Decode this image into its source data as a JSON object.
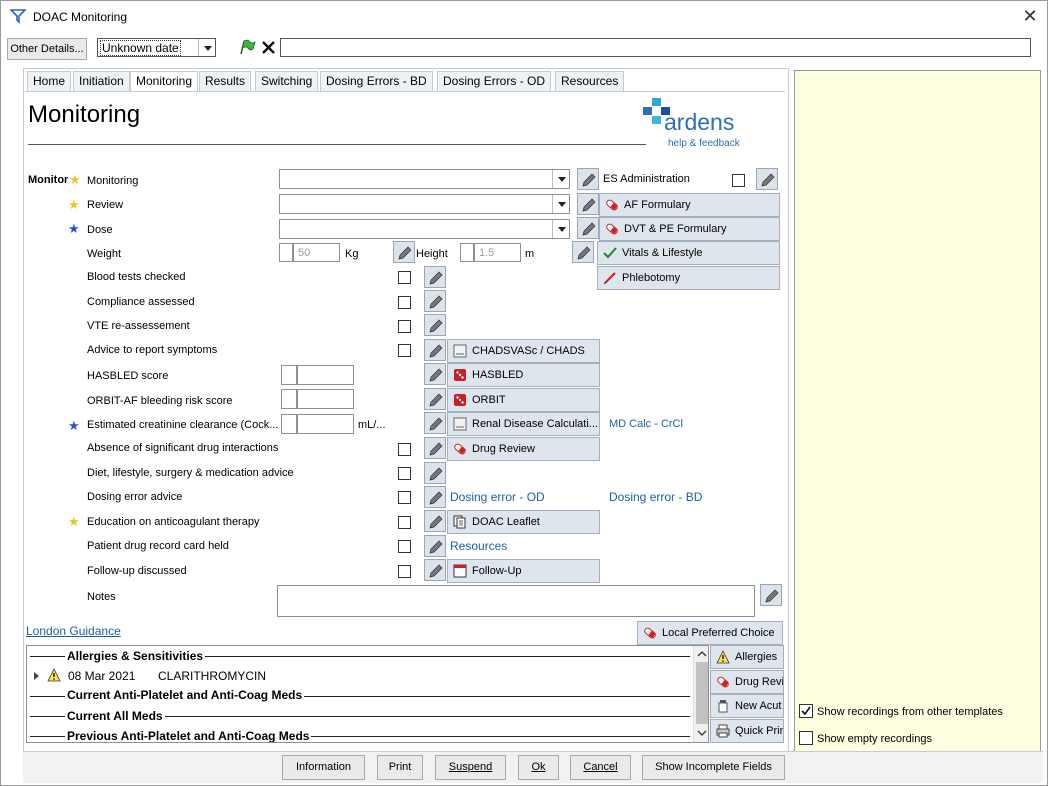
{
  "window": {
    "title": "DOAC Monitoring",
    "close_glyph": "✕"
  },
  "toolbar": {
    "other_details": "Other Details...",
    "date_value": "Unknown date",
    "text_value": ""
  },
  "tabs": [
    "Home",
    "Initiation",
    "Monitoring",
    "Results",
    "Switching",
    "Dosing Errors - BD",
    "Dosing Errors - OD",
    "Resources"
  ],
  "active_tab": "Monitoring",
  "page": {
    "heading": "Monitoring",
    "brand": "ardens",
    "brand_sub": "help & feedback"
  },
  "section_label": "Monitor",
  "rows": {
    "monitoring": "Monitoring",
    "review": "Review",
    "dose": "Dose",
    "weight": "Weight",
    "weight_value": "50",
    "weight_unit": "Kg",
    "height": "Height",
    "height_value": "1.5",
    "height_unit": "m",
    "blood_tests": "Blood tests checked",
    "compliance": "Compliance assessed",
    "vte": "VTE re-assessement",
    "advice": "Advice to report symptoms",
    "hasbled_score": "HASBLED score",
    "orbit_score": "ORBIT-AF bleeding risk score",
    "crcl": "Estimated creatinine clearance (Cock...",
    "crcl_unit": "mL/...",
    "drug_interactions": "Absence of significant drug interactions",
    "diet": "Diet, lifestyle, surgery & medication advice",
    "dosing_error": "Dosing error advice",
    "education": "Education on anticoagulant therapy",
    "record_card": "Patient drug record card held",
    "follow_up": "Follow-up discussed",
    "notes": "Notes"
  },
  "side_buttons": {
    "es_admin": "ES Administration",
    "af_formulary": "AF Formulary",
    "dvt_formulary": "DVT & PE Formulary",
    "vitals": "Vitals & Lifestyle",
    "phlebotomy": "Phlebotomy"
  },
  "calc_buttons": {
    "chadsvasc": "CHADSVASc / CHADS",
    "hasbled": "HASBLED",
    "orbit": "ORBIT",
    "renal": "Renal Disease Calculati...",
    "drug_review": "Drug Review",
    "doac_leaflet": "DOAC Leaflet",
    "follow_up": "Follow-Up"
  },
  "links": {
    "md_calc": "MD Calc - CrCl",
    "dosing_od": "Dosing error - OD",
    "dosing_bd": "Dosing error - BD",
    "resources": "Resources",
    "london": "London Guidance",
    "local_choice": "Local Preferred Choice"
  },
  "history": {
    "allergies_header": "Allergies & Sensitivities",
    "allergy_date": "08 Mar 2021",
    "allergy_drug": "CLARITHROMYCIN",
    "anti_platelet_header": "Current Anti-Platelet and Anti-Coag Meds",
    "all_meds_header": "Current All Meds",
    "previous_header": "Previous Anti-Platelet and Anti-Coag Meds"
  },
  "history_buttons": {
    "allergies": "Allergies",
    "drug_review": "Drug Revi",
    "new_acute": "New Acut",
    "quick_print": "Quick Prin"
  },
  "options": {
    "show_other_templates": "Show recordings from other templates",
    "show_other_checked": true,
    "show_empty": "Show empty recordings",
    "show_empty_checked": false
  },
  "footer": {
    "information": "Information",
    "print": "Print",
    "suspend": "Suspend",
    "ok": "Ok",
    "cancel": "Cancel",
    "show_incomplete": "Show Incomplete Fields"
  },
  "colors": {
    "accent": "#1e5ea8",
    "side_panel": "#fefee0",
    "brand": "#2b6fb7"
  }
}
